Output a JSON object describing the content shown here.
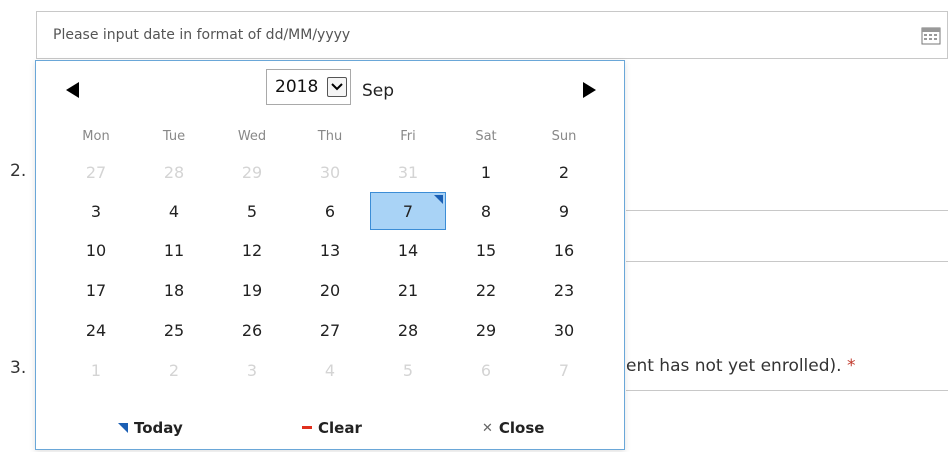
{
  "date_input": {
    "placeholder": "Please input date in format of dd/MM/yyyy"
  },
  "questions": {
    "q2_number": "2.",
    "q3_number": "3.",
    "q3_visible_text": "ent has not yet enrolled).",
    "required_mark": "*"
  },
  "calendar": {
    "year": "2018",
    "month": "Sep",
    "weekdays": [
      "Mon",
      "Tue",
      "Wed",
      "Thu",
      "Fri",
      "Sat",
      "Sun"
    ],
    "weeks": [
      [
        {
          "d": "27",
          "o": true
        },
        {
          "d": "28",
          "o": true
        },
        {
          "d": "29",
          "o": true
        },
        {
          "d": "30",
          "o": true
        },
        {
          "d": "31",
          "o": true
        },
        {
          "d": "1",
          "o": false
        },
        {
          "d": "2",
          "o": false
        }
      ],
      [
        {
          "d": "3",
          "o": false
        },
        {
          "d": "4",
          "o": false
        },
        {
          "d": "5",
          "o": false
        },
        {
          "d": "6",
          "o": false
        },
        {
          "d": "7",
          "o": false,
          "selected": true
        },
        {
          "d": "8",
          "o": false
        },
        {
          "d": "9",
          "o": false
        }
      ],
      [
        {
          "d": "10",
          "o": false
        },
        {
          "d": "11",
          "o": false
        },
        {
          "d": "12",
          "o": false
        },
        {
          "d": "13",
          "o": false
        },
        {
          "d": "14",
          "o": false
        },
        {
          "d": "15",
          "o": false
        },
        {
          "d": "16",
          "o": false
        }
      ],
      [
        {
          "d": "17",
          "o": false
        },
        {
          "d": "18",
          "o": false
        },
        {
          "d": "19",
          "o": false
        },
        {
          "d": "20",
          "o": false
        },
        {
          "d": "21",
          "o": false
        },
        {
          "d": "22",
          "o": false
        },
        {
          "d": "23",
          "o": false
        }
      ],
      [
        {
          "d": "24",
          "o": false
        },
        {
          "d": "25",
          "o": false
        },
        {
          "d": "26",
          "o": false
        },
        {
          "d": "27",
          "o": false
        },
        {
          "d": "28",
          "o": false
        },
        {
          "d": "29",
          "o": false
        },
        {
          "d": "30",
          "o": false
        }
      ],
      [
        {
          "d": "1",
          "o": true
        },
        {
          "d": "2",
          "o": true
        },
        {
          "d": "3",
          "o": true
        },
        {
          "d": "4",
          "o": true
        },
        {
          "d": "5",
          "o": true
        },
        {
          "d": "6",
          "o": true
        },
        {
          "d": "7",
          "o": true
        }
      ]
    ],
    "footer": {
      "today_label": "Today",
      "clear_label": "Clear",
      "close_label": "Close"
    },
    "colors": {
      "selected_bg": "#a9d3f6",
      "accent_blue": "#1b5fb4",
      "clear_red": "#e0301e"
    }
  }
}
